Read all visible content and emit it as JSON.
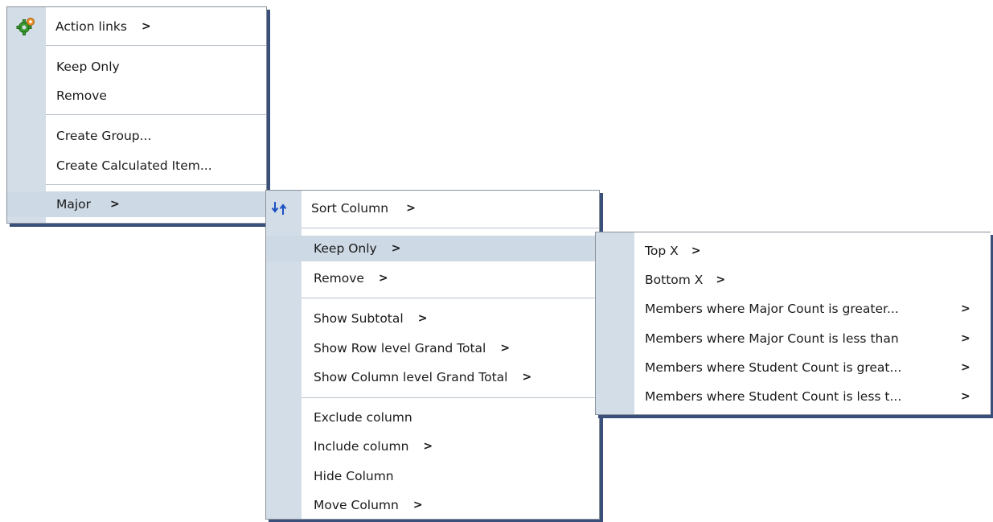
{
  "menu1": {
    "action_links": "Action links",
    "keep_only": "Keep Only",
    "remove": "Remove",
    "create_group": "Create Group...",
    "create_calculated_item": "Create Calculated Item...",
    "major": "Major",
    "arrow": ">"
  },
  "menu2": {
    "sort_column": "Sort Column",
    "keep_only": "Keep Only",
    "remove": "Remove",
    "show_subtotal": "Show Subtotal",
    "show_row_grand_total": "Show Row level Grand Total",
    "show_column_grand_total": "Show Column level Grand Total",
    "exclude_column": "Exclude column",
    "include_column": "Include column",
    "hide_column": "Hide Column",
    "move_column": "Move Column",
    "arrow": ">"
  },
  "menu3": {
    "top_x": "Top X",
    "bottom_x": "Bottom X",
    "major_greater": "Members where Major Count is greater...",
    "major_less": "Members where Major Count is less than",
    "student_greater": "Members where Student Count is great...",
    "student_less": "Members where Student Count is less t...",
    "arrow": ">"
  },
  "colors": {
    "gutter": "#d3dde7",
    "highlight": "#cdd9e4",
    "shadow": "#3a4f7a",
    "border": "#8a929c"
  }
}
